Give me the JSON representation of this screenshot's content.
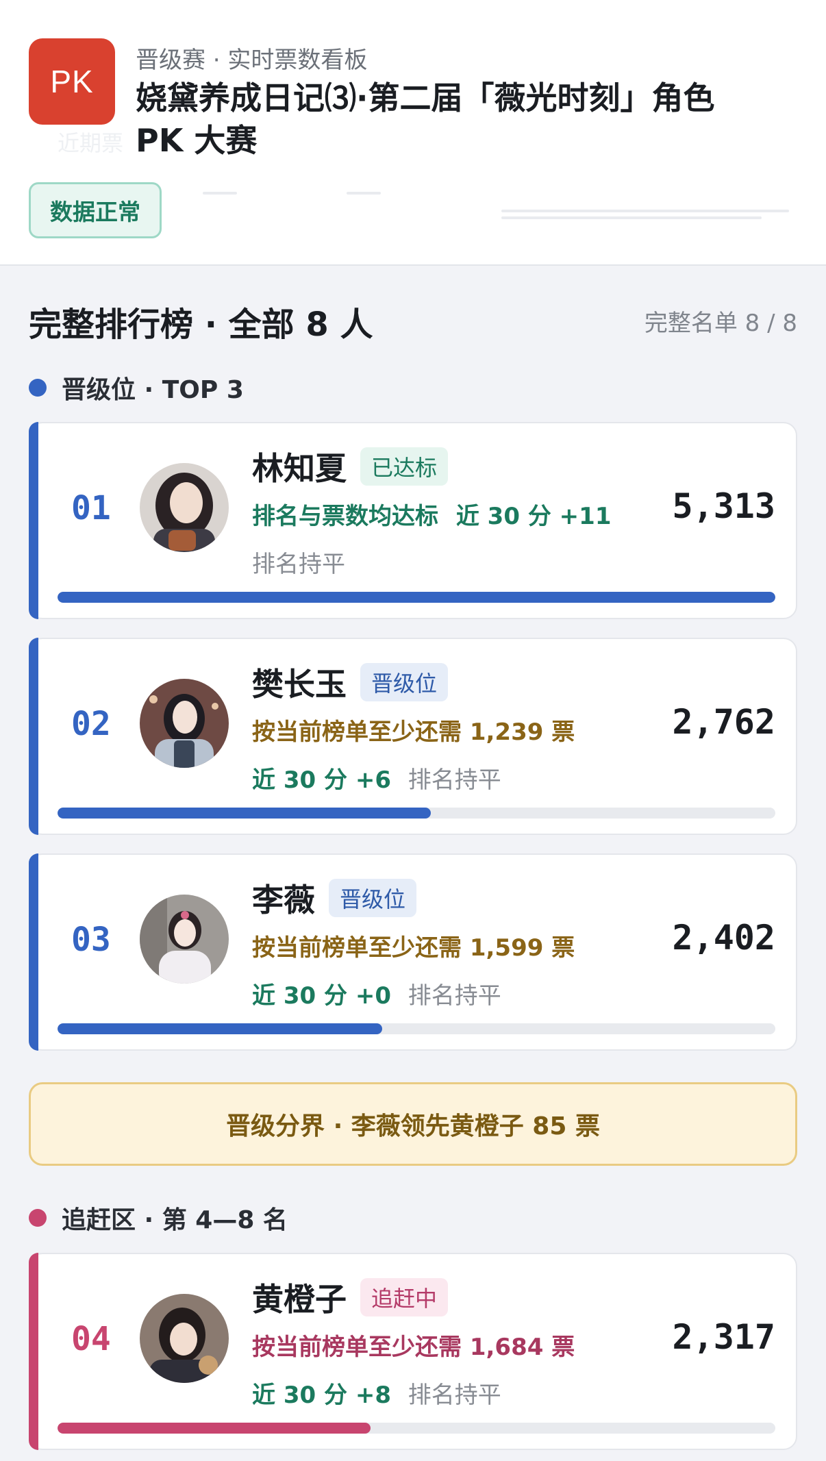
{
  "header": {
    "logo_text": "PK",
    "eyebrow": "晋级赛 · 实时票数看板",
    "title": "娆黛养成日记⑶·第二届「薇光时刻」角色 PK 大赛",
    "status": "数据正常"
  },
  "leaderboard": {
    "heading": "完整排行榜 · 全部 8 人",
    "count_label": "完整名单 8 / 8",
    "promo_group_label": "晋级位 · TOP 3",
    "chase_group_label": "追赶区 · 第 4—8 名",
    "boundary_text": "晋级分界 · 李薇领先黄橙子 85 票"
  },
  "entries": [
    {
      "rank": "01",
      "name": "林知夏",
      "tag": "已达标",
      "line2": "排名与票数均达标",
      "delta": "近 30 分 +11",
      "trend": "排名持平",
      "votes": "5,313",
      "progress": 1.0
    },
    {
      "rank": "02",
      "name": "樊长玉",
      "tag": "晋级位",
      "line2": "按当前榜单至少还需 1,239 票",
      "delta": "近 30 分 +6",
      "trend": "排名持平",
      "votes": "2,762",
      "progress": 0.52
    },
    {
      "rank": "03",
      "name": "李薇",
      "tag": "晋级位",
      "line2": "按当前榜单至少还需 1,599 票",
      "delta": "近 30 分 +0",
      "trend": "排名持平",
      "votes": "2,402",
      "progress": 0.452
    },
    {
      "rank": "04",
      "name": "黄橙子",
      "tag": "追赶中",
      "line2": "按当前榜单至少还需 1,684 票",
      "delta": "近 30 分 +8",
      "trend": "排名持平",
      "votes": "2,317",
      "progress": 0.436
    }
  ],
  "colors": {
    "promo_accent": "#3464c2",
    "chase_accent": "#c8456f",
    "logo_bg": "#d9412f"
  }
}
